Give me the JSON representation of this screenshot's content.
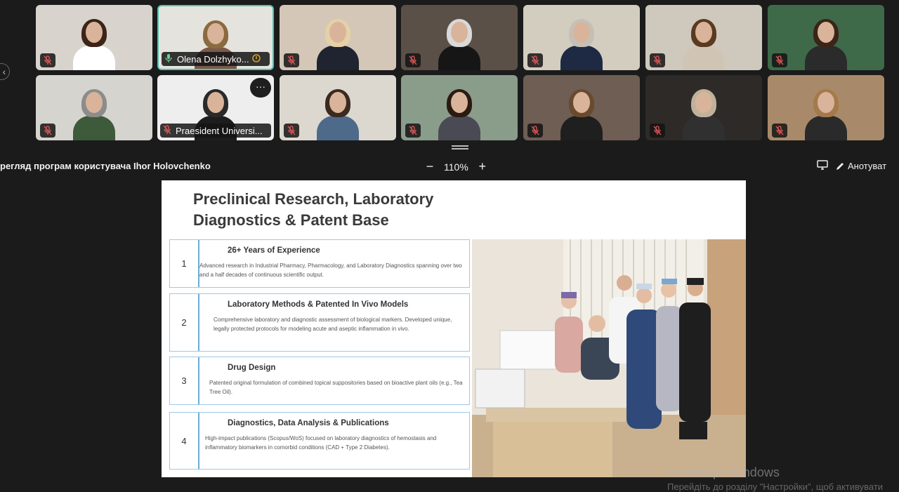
{
  "participants": [
    {
      "name": "",
      "muted": true,
      "bg": "#d8d3cc",
      "hair": "#3b2418",
      "cloth": "#ffffff"
    },
    {
      "name": "Olena Dolzhyko...",
      "muted": false,
      "active": true,
      "bg": "#e5e3de",
      "hair": "#8b6a3f",
      "cloth": "#7a5a4a"
    },
    {
      "name": "",
      "muted": true,
      "bg": "#d4c7b8",
      "hair": "#e4d2a6",
      "cloth": "#1f2430"
    },
    {
      "name": "",
      "muted": true,
      "bg": "#5a5048",
      "hair": "#d9d9d9",
      "cloth": "#161616"
    },
    {
      "name": "",
      "muted": true,
      "bg": "#d3cdbf",
      "hair": "#c4c0b8",
      "cloth": "#1e2a44"
    },
    {
      "name": "",
      "muted": true,
      "bg": "#cfc8bd",
      "hair": "#5a3a20",
      "cloth": "#d0c5b5"
    },
    {
      "name": "",
      "muted": true,
      "bg": "#3e6a4a",
      "hair": "#3a2516",
      "cloth": "#2b2b2b"
    },
    {
      "name": "",
      "muted": true,
      "bg": "#d6d4cf",
      "hair": "#8c8c8c",
      "cloth": "#3d5a3a"
    },
    {
      "name": "Praesident Universi...",
      "muted": true,
      "more": true,
      "bg": "#eeeeee",
      "hair": "#2a2a2a",
      "cloth": "#1d1d1d"
    },
    {
      "name": "",
      "muted": true,
      "bg": "#dcd8cf",
      "hair": "#3a2a20",
      "cloth": "#4e6a8a"
    },
    {
      "name": "",
      "muted": true,
      "bg": "#8a9c8a",
      "hair": "#2a1a12",
      "cloth": "#4a4a55"
    },
    {
      "name": "",
      "muted": true,
      "bg": "#6e5e54",
      "hair": "#6a4a2e",
      "cloth": "#1f1f1f"
    },
    {
      "name": "",
      "muted": true,
      "bg": "#2e2a28",
      "hair": "#bfb29c",
      "cloth": "#303030"
    },
    {
      "name": "",
      "muted": true,
      "bg": "#a88a6a",
      "hair": "#a57a4a",
      "cloth": "#2a2a2a"
    }
  ],
  "toolbar": {
    "share_title": "регляд програм користувача Ihor Holovchenko",
    "zoom_minus": "−",
    "zoom_level": "110%",
    "zoom_plus": "+",
    "annotate_label": "Анотуват"
  },
  "slide": {
    "title": "Preclinical Research, Laboratory Diagnostics & Patent Base",
    "cards": [
      {
        "num": "1",
        "title": "26+ Years of Experience",
        "desc": "Advanced research in Industrial Pharmacy, Pharmacology, and Laboratory Diagnostics spanning over two and a half decades of continuous scientific output."
      },
      {
        "num": "2",
        "title": "Laboratory Methods & Patented In Vivo Models",
        "desc": "Comprehensive laboratory and diagnostic assessment of biological markers. Developed unique, legally protected protocols for modeling acute and aseptic inflammation in vivo."
      },
      {
        "num": "3",
        "title": "Drug Design",
        "desc": "Patented original formulation of combined topical suppositories based on bioactive plant oils (e.g., Tea Tree Oil)."
      },
      {
        "num": "4",
        "title": "Diagnostics, Data Analysis & Publications",
        "desc": "High-impact publications (Scopus/WoS) focused on laboratory diagnostics of hemostasis and inflammatory biomarkers in comorbid conditions (CAD + Type 2 Diabetes)."
      }
    ]
  },
  "watermark": {
    "line1": "Активація Windows",
    "line2": "Перейдіть до розділу \"Настройки\", щоб активувати"
  },
  "colors": {
    "active_border": "#4fc3b0",
    "card_border": "#9ec9e6",
    "muted_icon": "#e05a5a"
  }
}
